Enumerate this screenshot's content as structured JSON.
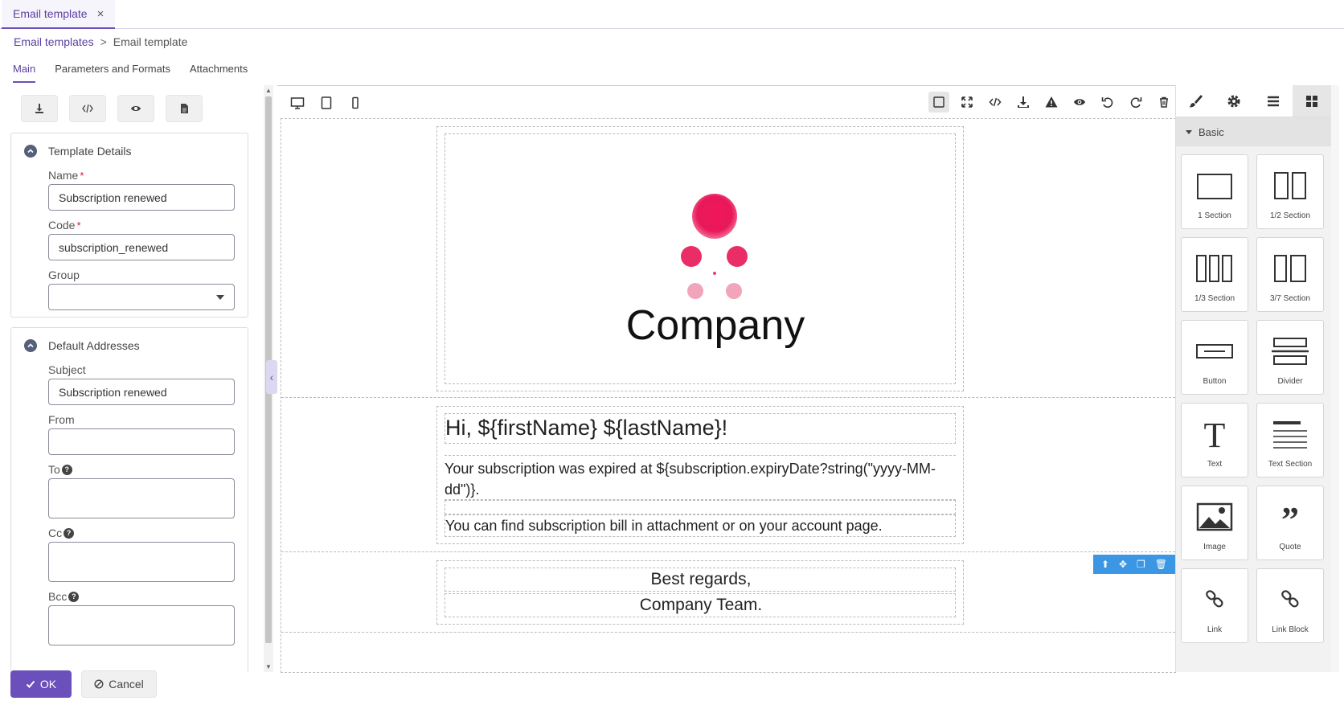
{
  "window_tab": {
    "label": "Email template",
    "close": "×"
  },
  "breadcrumb": {
    "parent": "Email templates",
    "separator": ">",
    "current": "Email template"
  },
  "subtabs": [
    "Main",
    "Parameters and Formats",
    "Attachments"
  ],
  "template_details": {
    "title": "Template Details",
    "name_label": "Name",
    "name_value": "Subscription renewed",
    "code_label": "Code",
    "code_value": "subscription_renewed",
    "group_label": "Group",
    "group_value": "",
    "required_mark": "*"
  },
  "default_addresses": {
    "title": "Default Addresses",
    "subject_label": "Subject",
    "subject_value": "Subscription renewed",
    "from_label": "From",
    "from_value": "",
    "to_label": "To",
    "cc_label": "Cc",
    "bcc_label": "Bcc"
  },
  "footer": {
    "ok": "OK",
    "cancel": "Cancel"
  },
  "canvas": {
    "logo_text": "Company",
    "greeting": "Hi, ${firstName} ${lastName}!",
    "para1": "Your subscription was expired at ${subscription.expiryDate?string(\"yyyy-MM-dd\")}.",
    "para2": "You can find subscription bill in attachment or on your account page.",
    "sign1": "Best regards,",
    "sign2": "Company Team."
  },
  "blocks_panel": {
    "category": "Basic",
    "items": [
      "1 Section",
      "1/2 Section",
      "1/3 Section",
      "3/7 Section",
      "Button",
      "Divider",
      "Text",
      "Text Section",
      "Image",
      "Quote",
      "Link",
      "Link Block"
    ]
  },
  "colors": {
    "accent": "#6b4fbb",
    "logo_pink": "#e8185a",
    "tool_blue": "#3b97e3"
  }
}
